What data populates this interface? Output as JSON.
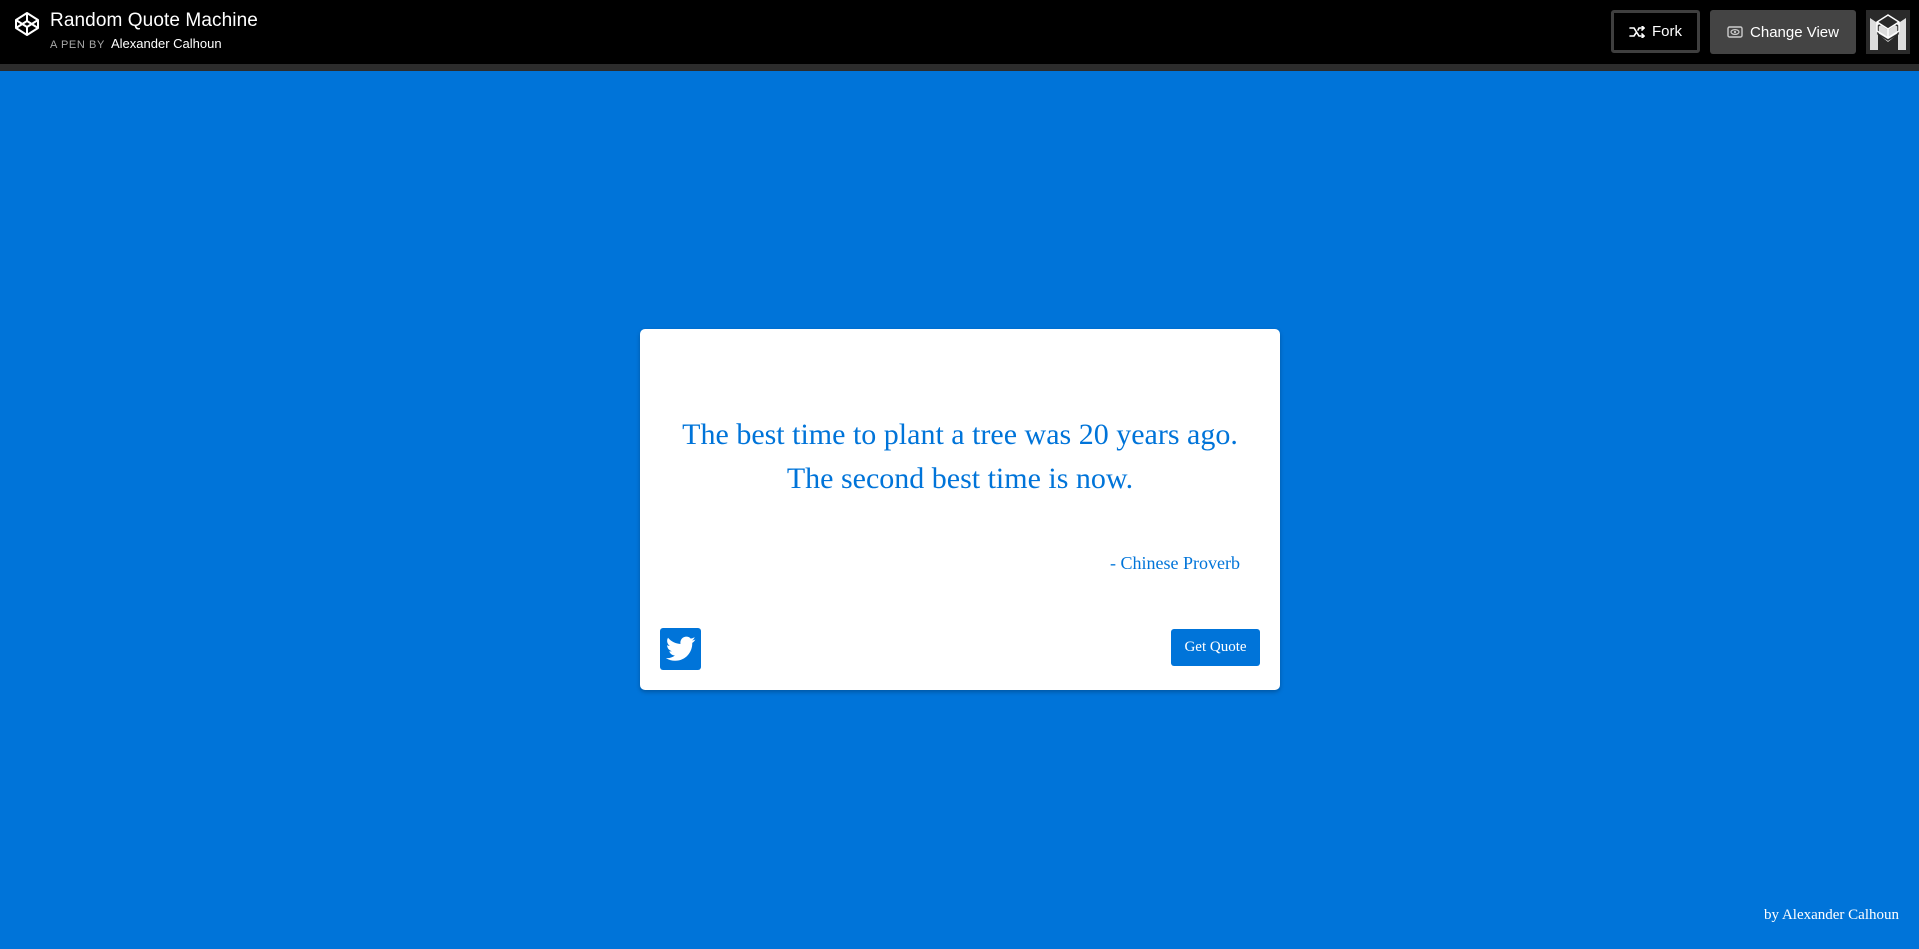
{
  "header": {
    "title": "Random Quote Machine",
    "byline_label": "A PEN BY",
    "author": "Alexander Calhoun",
    "logo_icon": "codepen-logo-icon",
    "fork_label": "Fork",
    "fork_icon": "fork-icon",
    "change_view_label": "Change View",
    "change_view_icon": "eye-window-icon",
    "avatar_icon": "codepen-avatar-icon"
  },
  "quote": {
    "text": "The best time to plant a tree was 20 years ago. The second best time is now.",
    "author": "- Chinese Proverb"
  },
  "actions": {
    "tweet_icon": "twitter-icon",
    "get_quote_label": "Get Quote"
  },
  "footer": {
    "credit": "by Alexander Calhoun"
  },
  "colors": {
    "accent": "#0074d9",
    "topbar": "#000000",
    "card": "#ffffff"
  }
}
